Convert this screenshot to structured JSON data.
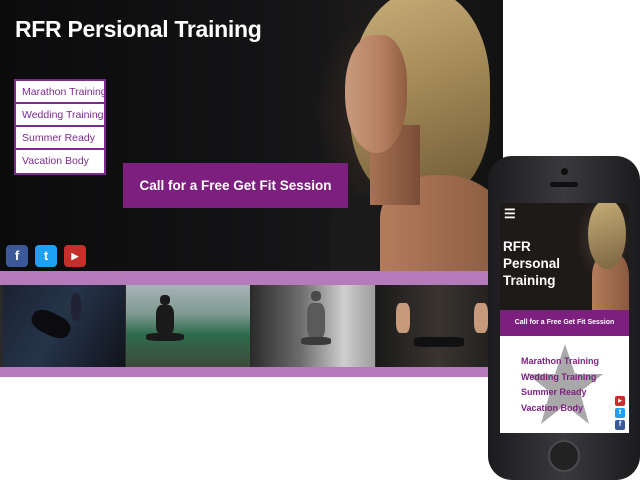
{
  "desktop": {
    "title": "RFR Persional Training",
    "menu": [
      {
        "label": "Marathon Training"
      },
      {
        "label": "Wedding Training"
      },
      {
        "label": "Summer Ready"
      },
      {
        "label": "Vacation Body"
      }
    ],
    "cta_label": "Call for a Free Get Fit Session",
    "social_icons": [
      "facebook-icon",
      "twitter-icon",
      "youtube-icon"
    ],
    "gallery_photos": 4
  },
  "mobile": {
    "menu_icon": "hamburger-icon",
    "title": "RFR Personal Training",
    "cta_label": "Call for a Free Get Fit Session",
    "menu": [
      {
        "label": "Marathon Training"
      },
      {
        "label": "Wedding Training"
      },
      {
        "label": "Summer Ready"
      },
      {
        "label": "Vacation Body"
      }
    ],
    "social_icons": [
      "youtube-icon",
      "twitter-icon",
      "facebook-icon"
    ]
  },
  "colors": {
    "brand_purple": "#7c1f7f",
    "strip_lilac": "#b47ab9",
    "facebook": "#3b5998",
    "twitter": "#1da1f2",
    "youtube": "#c4302b"
  }
}
